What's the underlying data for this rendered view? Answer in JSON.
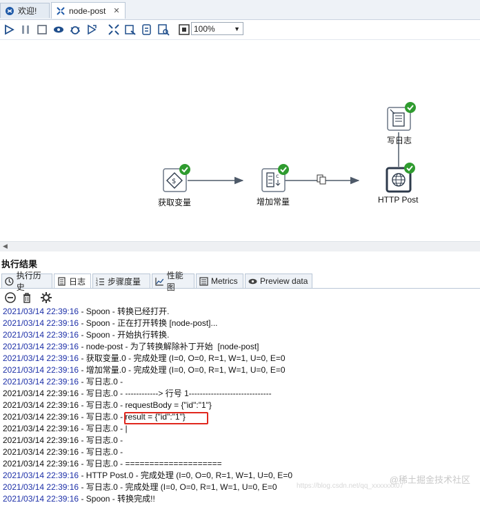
{
  "tabs": [
    {
      "label": "欢迎!",
      "icon": "welcome-icon"
    },
    {
      "label": "node-post",
      "icon": "transformation-icon",
      "close": "✕"
    }
  ],
  "toolbar": {
    "icons": [
      "run-icon",
      "pause-icon",
      "stop-icon",
      "preview-icon",
      "debug-icon",
      "replay-icon",
      "verify-icon",
      "impact-icon",
      "sql-icon",
      "explore-db-icon",
      "layout-icon"
    ],
    "zoom": "100%"
  },
  "canvas": {
    "nodes": [
      {
        "id": "get-variables",
        "label": "获取变量",
        "icon": "variable-icon",
        "status": "success"
      },
      {
        "id": "add-constants",
        "label": "增加常量",
        "icon": "constant-icon",
        "status": "success"
      },
      {
        "id": "http-post",
        "label": "HTTP Post",
        "icon": "globe-icon",
        "status": "success"
      },
      {
        "id": "write-log",
        "label": "写日志",
        "icon": "log-icon",
        "status": "success"
      }
    ]
  },
  "results": {
    "title": "执行结果",
    "tabs": [
      "执行历史",
      "日志",
      "步骤度量",
      "性能图",
      "Metrics",
      "Preview data"
    ],
    "active_tab": "日志"
  },
  "log": [
    {
      "ts": "2021/03/14 22:39:16",
      "msg": " - Spoon - 转换已经打开.",
      "blue": true
    },
    {
      "ts": "2021/03/14 22:39:16",
      "msg": " - Spoon - 正在打开转换 [node-post]...",
      "blue": true
    },
    {
      "ts": "2021/03/14 22:39:16",
      "msg": " - Spoon - 开始执行转换.",
      "blue": true
    },
    {
      "ts": "2021/03/14 22:39:16",
      "msg": " - node-post - 为了转换解除补丁开始  [node-post]",
      "blue": true
    },
    {
      "ts": "2021/03/14 22:39:16",
      "msg": " - 获取变量.0 - 完成处理 (I=0, O=0, R=1, W=1, U=0, E=0",
      "blue": true
    },
    {
      "ts": "2021/03/14 22:39:16",
      "msg": " - 增加常量.0 - 完成处理 (I=0, O=0, R=1, W=1, U=0, E=0",
      "blue": true
    },
    {
      "ts": "2021/03/14 22:39:16",
      "msg": " - 写日志.0 -",
      "blue": true
    },
    {
      "ts": "2021/03/14 22:39:16",
      "msg": " - 写日志.0 - ------------> 行号 1------------------------------",
      "blue": false
    },
    {
      "ts": "2021/03/14 22:39:16",
      "msg": " - 写日志.0 - requestBody = {\"id\":\"1\"}",
      "blue": false
    },
    {
      "ts": "2021/03/14 22:39:16",
      "msg": " - 写日志.0 - result = {\"id\":\"1\"}",
      "blue": false
    },
    {
      "ts": "2021/03/14 22:39:16",
      "msg": " - 写日志.0 - |",
      "blue": false
    },
    {
      "ts": "2021/03/14 22:39:16",
      "msg": " - 写日志.0 -",
      "blue": false
    },
    {
      "ts": "2021/03/14 22:39:16",
      "msg": " - 写日志.0 -",
      "blue": false
    },
    {
      "ts": "2021/03/14 22:39:16",
      "msg": " - 写日志.0 - ====================",
      "blue": false
    },
    {
      "ts": "2021/03/14 22:39:16",
      "msg": " - HTTP Post.0 - 完成处理 (I=0, O=0, R=1, W=1, U=0, E=0",
      "blue": true
    },
    {
      "ts": "2021/03/14 22:39:16",
      "msg": " - 写日志.0 - 完成处理 (I=0, O=0, R=1, W=1, U=0, E=0",
      "blue": true
    },
    {
      "ts": "2021/03/14 22:39:16",
      "msg": " - Spoon - 转换完成!!",
      "blue": true
    }
  ],
  "watermark": "@稀土掘金技术社区",
  "watermark_url": "https://blog.csdn.net/qq_xxxxxxx07"
}
